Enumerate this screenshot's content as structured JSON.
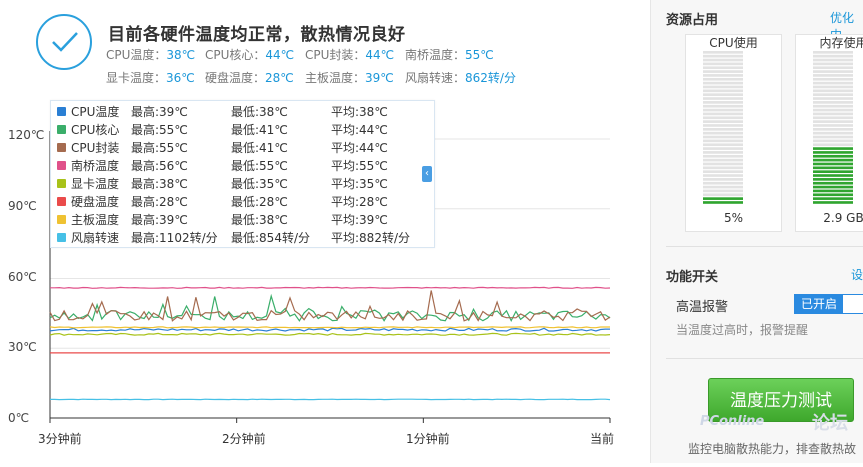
{
  "status": {
    "title": "目前各硬件温度均正常，散热情况良好",
    "row1": [
      {
        "label": "CPU温度：",
        "value": "38℃"
      },
      {
        "label": "CPU核心：",
        "value": "44℃"
      },
      {
        "label": "CPU封装：",
        "value": "44℃"
      },
      {
        "label": "南桥温度：",
        "value": "55℃"
      }
    ],
    "row2": [
      {
        "label": "显卡温度：",
        "value": "36℃"
      },
      {
        "label": "硬盘温度：",
        "value": "28℃"
      },
      {
        "label": "主板温度：",
        "value": "39℃"
      },
      {
        "label": "风扇转速：",
        "value": "862转/分"
      }
    ]
  },
  "chart_data": {
    "type": "line",
    "title": "",
    "xlabel": "",
    "ylabel": "",
    "ylim": [
      0,
      120
    ],
    "yticks": [
      "120℃",
      "90℃",
      "60℃",
      "30℃",
      "0℃"
    ],
    "xticks": [
      "3分钟前",
      "2分钟前",
      "1分钟前",
      "当前"
    ],
    "grid": true,
    "series": [
      {
        "name": "CPU温度",
        "color": "#2a7fd4",
        "max": "最高:39℃",
        "min": "最低:38℃",
        "avg": "平均:38℃",
        "level": 38
      },
      {
        "name": "CPU核心",
        "color": "#3aae6a",
        "max": "最高:55℃",
        "min": "最低:41℃",
        "avg": "平均:44℃",
        "level": 44
      },
      {
        "name": "CPU封装",
        "color": "#a56b4f",
        "max": "最高:55℃",
        "min": "最低:41℃",
        "avg": "平均:44℃",
        "level": 44
      },
      {
        "name": "南桥温度",
        "color": "#e0518a",
        "max": "最高:56℃",
        "min": "最低:55℃",
        "avg": "平均:55℃",
        "level": 56
      },
      {
        "name": "显卡温度",
        "color": "#a8c21a",
        "max": "最高:38℃",
        "min": "最低:35℃",
        "avg": "平均:35℃",
        "level": 36
      },
      {
        "name": "硬盘温度",
        "color": "#ea4b4b",
        "max": "最高:28℃",
        "min": "最低:28℃",
        "avg": "平均:28℃",
        "level": 28
      },
      {
        "name": "主板温度",
        "color": "#efc232",
        "max": "最高:39℃",
        "min": "最低:38℃",
        "avg": "平均:39℃",
        "level": 39
      },
      {
        "name": "风扇转速",
        "color": "#46c0e6",
        "max": "最高:1102转/分",
        "min": "最低:854转/分",
        "avg": "平均:882转/分",
        "level": 8
      }
    ]
  },
  "resources": {
    "title": "资源占用",
    "link": "优化内",
    "cpu": {
      "label": "CPU使用",
      "value": "5%",
      "fraction": 0.05
    },
    "mem": {
      "label": "内存使用",
      "value": "2.9 GB",
      "fraction": 0.38
    }
  },
  "features": {
    "title": "功能开关",
    "link": "设",
    "alarm_label": "高温报警",
    "toggle_on": "已开启",
    "alarm_desc": "当温度过高时，报警提醒"
  },
  "stress": {
    "button": "温度压力测试",
    "desc": "监控电脑散热能力，排查散热故"
  },
  "watermark": {
    "brand": "PConline",
    "site": "论坛"
  }
}
